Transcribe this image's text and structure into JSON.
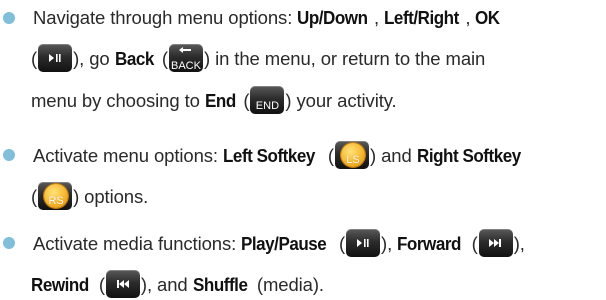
{
  "bullets": [
    {
      "line1": {
        "t1": "Navigate through menu options: ",
        "k1": "Up/Down",
        "t2": ", ",
        "k2": "Left/Right",
        "t3": ", ",
        "k3": "OK"
      },
      "line2": {
        "t1": "(",
        "t2": "), go ",
        "k1": "Back",
        "t3": " (",
        "t4": ") in the menu, or return to the main"
      },
      "line3": {
        "t1": "menu by choosing to ",
        "k1": "End",
        "t2": " (",
        "t3": ") your activity."
      },
      "icons": {
        "ok": "play-pause-icon",
        "back_label": "BACK",
        "end_label": "END"
      }
    },
    {
      "line1": {
        "t1": "Activate menu options: ",
        "k1": "Left Softkey",
        "t2": " (",
        "t3": ") and ",
        "k2": "Right Softkey"
      },
      "line2": {
        "t1": "(",
        "t2": ") options."
      },
      "icons": {
        "ls_label": "LS",
        "rs_label": "RS"
      }
    },
    {
      "line1": {
        "t1": "Activate media functions: ",
        "k1": "Play/Pause",
        "t2": " (",
        "t3": "), ",
        "k2": "Forward",
        "t4": " (",
        "t5": "),"
      },
      "line2": {
        "k1": "Rewind",
        "t1": " (",
        "t2": "), and ",
        "k2": "Shuffle",
        "t3": " (media)."
      },
      "icons": {
        "play": "play-pause-icon",
        "forward": "fast-forward-icon",
        "rewind": "rewind-icon"
      }
    }
  ],
  "colors": {
    "bullet": "#7fbfda",
    "key_dark": "#2c2c2c",
    "key_orange": "#f6b72e",
    "text": "#2a2a2a"
  }
}
